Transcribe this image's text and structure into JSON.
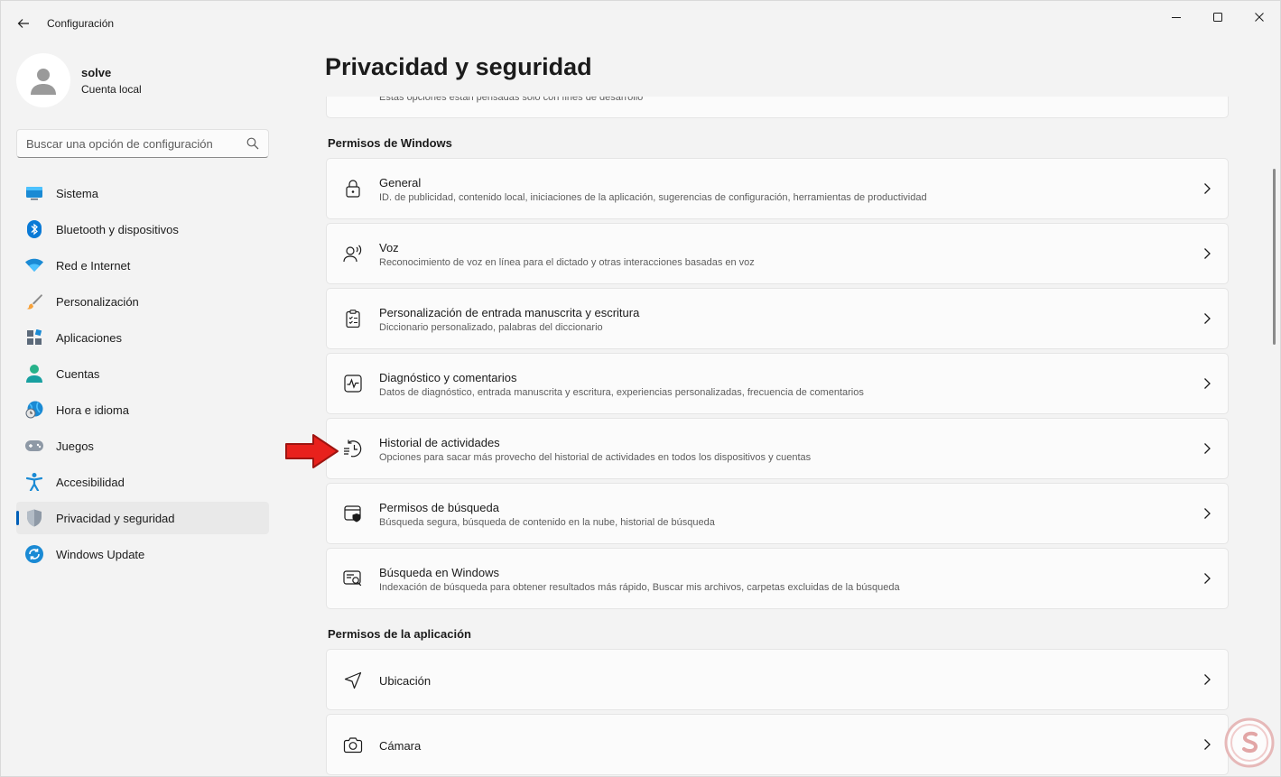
{
  "window": {
    "title": "Configuración"
  },
  "profile": {
    "name": "solve",
    "account_type": "Cuenta local"
  },
  "search": {
    "placeholder": "Buscar una opción de configuración"
  },
  "nav": {
    "items": [
      {
        "label": "Sistema",
        "icon": "monitor-icon"
      },
      {
        "label": "Bluetooth y dispositivos",
        "icon": "bluetooth-icon"
      },
      {
        "label": "Red e Internet",
        "icon": "wifi-icon"
      },
      {
        "label": "Personalización",
        "icon": "brush-icon"
      },
      {
        "label": "Aplicaciones",
        "icon": "apps-icon"
      },
      {
        "label": "Cuentas",
        "icon": "person-icon"
      },
      {
        "label": "Hora e idioma",
        "icon": "globe-clock-icon"
      },
      {
        "label": "Juegos",
        "icon": "gamepad-icon"
      },
      {
        "label": "Accesibilidad",
        "icon": "accessibility-icon"
      },
      {
        "label": "Privacidad y seguridad",
        "icon": "shield-icon",
        "active": true
      },
      {
        "label": "Windows Update",
        "icon": "update-icon"
      }
    ]
  },
  "page": {
    "title": "Privacidad y seguridad",
    "partial_card_desc": "Estas opciones están pensadas solo con fines de desarrollo",
    "section_windows": "Permisos de Windows",
    "section_app": "Permisos de la aplicación",
    "windows_items": [
      {
        "title": "General",
        "desc": "ID. de publicidad, contenido local, iniciaciones de la aplicación, sugerencias de configuración, herramientas de productividad",
        "icon": "lock-icon"
      },
      {
        "title": "Voz",
        "desc": "Reconocimiento de voz en línea para el dictado y otras interacciones basadas en voz",
        "icon": "speech-icon"
      },
      {
        "title": "Personalización de entrada manuscrita y escritura",
        "desc": "Diccionario personalizado, palabras del diccionario",
        "icon": "clipboard-icon"
      },
      {
        "title": "Diagnóstico y comentarios",
        "desc": "Datos de diagnóstico, entrada manuscrita y escritura, experiencias personalizadas, frecuencia de comentarios",
        "icon": "pulse-icon"
      },
      {
        "title": "Historial de actividades",
        "desc": "Opciones para sacar más provecho del historial de actividades en todos los dispositivos y cuentas",
        "icon": "history-icon"
      },
      {
        "title": "Permisos de búsqueda",
        "desc": "Búsqueda segura, búsqueda de contenido en la nube, historial de búsqueda",
        "icon": "search-shield-icon"
      },
      {
        "title": "Búsqueda en Windows",
        "desc": "Indexación de búsqueda para obtener resultados más rápido, Buscar mis archivos, carpetas excluidas de la búsqueda",
        "icon": "search-window-icon"
      }
    ],
    "app_items": [
      {
        "title": "Ubicación",
        "icon": "location-icon"
      },
      {
        "title": "Cámara",
        "icon": "camera-icon"
      }
    ]
  },
  "colors": {
    "accent": "#005fb8",
    "arrow": "#e8211c",
    "background": "#f3f3f3",
    "card": "#fbfbfb"
  }
}
